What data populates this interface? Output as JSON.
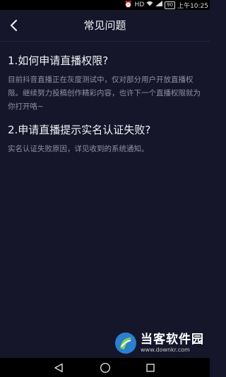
{
  "status_bar": {
    "alarm_icon": "alarm-icon",
    "hd_label": "HD",
    "wifi_icon": "wifi-icon",
    "signal_icon": "signal-icon",
    "battery_level": "90",
    "time": "上午10:25"
  },
  "header": {
    "back_icon": "chevron-left-icon",
    "title": "常见问题"
  },
  "faq": [
    {
      "question": "1.如何申请直播权限?",
      "answer": "目前抖音直播正在灰度测试中，仅对部分用户开放直播权限。继续努力投稿创作精彩内容，也许下一个直播权限就为你打开咯~"
    },
    {
      "question": "2.申请直播提示实名认证失败?",
      "answer": "实名认证失败原因，详见收到的系统通知。"
    }
  ],
  "watermark": {
    "title": "当客软件园",
    "url": "www.downkr.com"
  },
  "nav_bar": {
    "back_icon": "triangle-back-icon",
    "home_icon": "circle-home-icon",
    "recents_icon": "square-recents-icon"
  }
}
